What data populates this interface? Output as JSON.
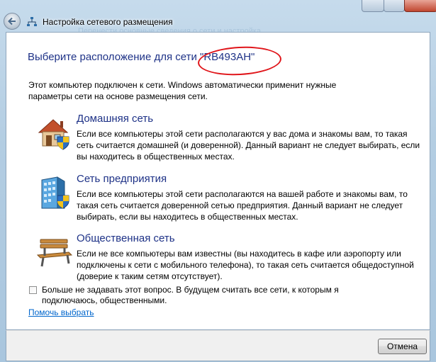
{
  "window": {
    "title": "Настройка сетевого размещения",
    "background_hint": "Перенести основные сведения о сети и настройка"
  },
  "heading": {
    "prefix": "Выберите расположение для сети ",
    "network_name": "\"RB493AH\""
  },
  "intro": "Этот компьютер подключен к сети. Windows автоматически применит нужные параметры сети на основе размещения сети.",
  "options": [
    {
      "title": "Домашняя сеть",
      "description": "Если все компьютеры этой сети располагаются у вас дома и знакомы вам, то такая сеть считается домашней (и доверенной). Данный вариант не следует выбирать, если вы находитесь в общественных местах.",
      "icon": "home-icon"
    },
    {
      "title": "Сеть предприятия",
      "description": "Если все компьютеры этой сети располагаются на вашей работе и знакомы вам, то такая сеть считается доверенной сетью предприятия. Данный вариант не следует выбирать, если вы находитесь в общественных местах.",
      "icon": "office-building-icon"
    },
    {
      "title": "Общественная сеть",
      "description": "Если не все компьютеры вам известны (вы находитесь в кафе или аэропорту или подключены к сети с мобильного телефона), то такая сеть считается общедоступной (доверие к таким сетям отсутствует).",
      "icon": "park-bench-icon"
    }
  ],
  "dont_ask": {
    "label": "Больше не задавать этот вопрос. В будущем считать все сети, к которым я подключаюсь, общественными.",
    "checked": false
  },
  "help_link": "Помочь выбрать",
  "buttons": {
    "cancel": "Отмена"
  },
  "colors": {
    "accent_blue": "#1e3287",
    "link": "#0066cc",
    "annotation_red": "#e0151a"
  }
}
